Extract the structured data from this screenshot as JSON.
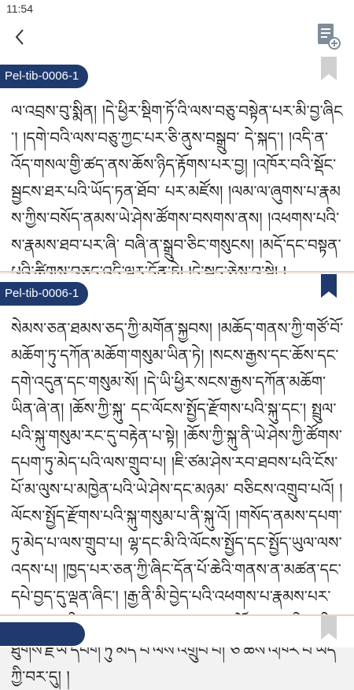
{
  "status_bar": {
    "time": "11:54"
  },
  "nav": {
    "back_icon": "chevron-left-icon",
    "notes_icon": "notebook-add-icon"
  },
  "colors": {
    "pill": "#1e3a6e",
    "bookmark_inactive": "#d0d0d0",
    "bookmark_active": "#1e3a6e",
    "divider": "#ead2c4"
  },
  "entries": [
    {
      "id": "Pel-tib-0006-1",
      "bookmarked": false,
      "text": "ལ་འབྲས་བུ་སྨིན། །དེ་ཕྱིར་སྡིག་ཏོ་འི་ལས་བཅུ་བསྟེན་པར་མི་བྱ་ཞིང་། །དགེ་བའི་ལས་བཅུ་ཀྱང་པར་ཅི་ནུས་བསྒྲུབ་ དེ་སྐད་། །འདི་ན་འོད་གསལ་གྱི་ཚད་ནས་ཆོས་ཉིད་རྟོགས་པར་བྱ། །འཁོར་བའི་སྡོང་སྦྱངས་ཐར་པའི་ཡོད་ཏན་ཐོབ་ པར་མཛོས། །ལམ་ལ་ཞུགས་པ་རྣམས་ཀྱིས་བསོད་ནམས་ཡེ་ཤེས་ཚོགས་བསགས་ནས། །འཕགས་པའི་ས་རྣམས་ཐབ་པར་ཞི་ བཞི་ན་སྒྲུབ་ཅིང་གསུངས། །མདོ་དང་བསྟན་པའི་ཚིགས་བཅད་འདི་ལྟར་དོན་ཏེ། །དེ་སྐད་ཅེས་བྱ་སྟེ། །"
    },
    {
      "id": "Pel-tib-0006-1",
      "bookmarked": true,
      "text": "སེམས་ཅན་ཐམས་ཅད་ཀྱི་མགོན་སྐྱབས། །མཆོད་གནས་ཀྱི་གཙོ་བོ་མཆོག་ཏུ་དཀོན་མཆོག་གསུམ་ཡིན་ཏེ། །སངས་རྒྱས་དང་ཆོས་དང་དགེ་འདུན་དང་གསུམ་སོ། །དེ་ཡི་ཕྱིར་སངས་རྒྱས་དཀོན་མཆོག་ཡིན་ཞེ་ན། །ཆོས་ཀྱི་སྐུ་ དང་ལོངས་སྤྱོད་རྫོགས་པའི་སྐུ་དང་། སྤྲུལ་པའི་སྐུ་གསུམ་རང་དུ་བརྟེན་པ་སྟེ། །ཆོས་ཀྱི་སྐུ་ནི་ཡེ་ཤེས་ཀྱི་ཚོགས་ དཔག་ཏུ་མེད་པའི་ལས་གྲུབ་པ། །ཇི་ཙམ་ཤེས་རབ་ཐབས་པའི་ངོས་པོ་མ་ལུས་པ་མཁྱེན་པའི་ཡེ་ཤེས་དང་མཉམ་ བཅིངས་འགྲུབ་པའོ། །ལོངས་སྤྱོད་རྫོགས་པའི་སྐུ་གསུམ་པ་ནི་སྐུ་འོ། །གསོད་ནམས་དཔག་ཏུ་མེད་པ་ལས་གྲུབ་པ། ལྷ་དང་མི་འི་ལོངས་སྤྱོད་དང་སྤྱོད་ཡུལ་ལས་འདས་པ། །ཁྱད་པར་ཅན་ཀྱི་ཞིང་དོན་པོ་ཆེའི་གནས་ན་མཚན་དང་ དཔེ་བྱད་དུ་ལྡན་ཞིང་། །རྒྱ་ནི་མི་བྱེད་པའི་འཕགས་པ་རྣམས་པར་སྣང་མཛད་ཀྱི་སྐུ་གསལ་འདུད་དུ་བཞུགས་ པའོ། །སྤྲུལ་པའི་སྐུ་ནི་ཐུགས་རྗེ་ཡི་དཔག་ཏུ་མེད་པ་ལས་འགྲུབ་པ། ཅི་ཆོས་འཁོར་བ་ཡོད་ཀྱི་བར་དུ། །"
    },
    {
      "id": "Pel-tib-0006-1",
      "bookmarked": false,
      "text": ""
    }
  ]
}
